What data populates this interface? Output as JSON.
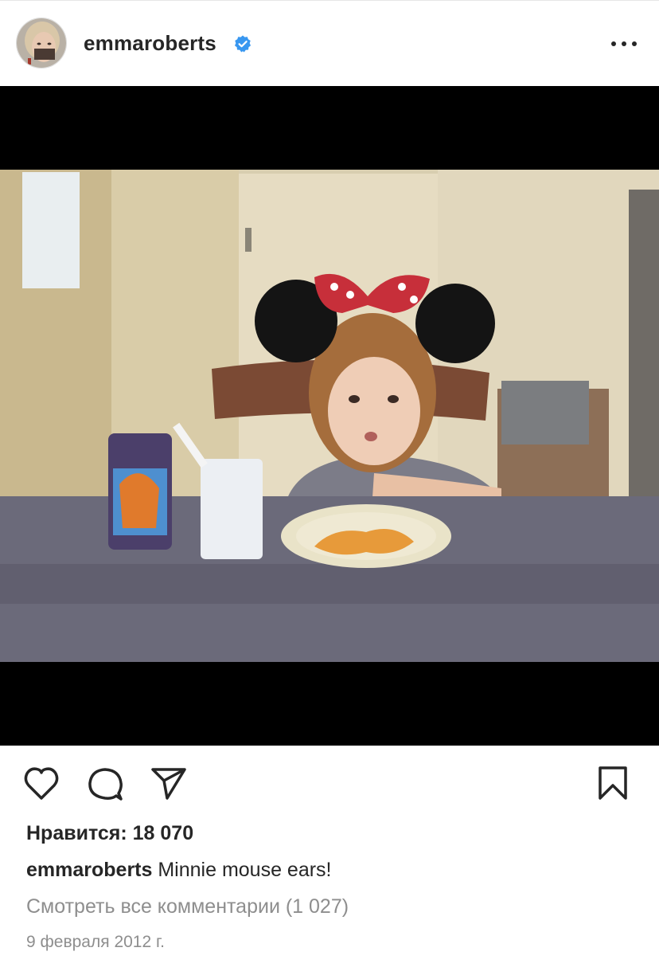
{
  "post": {
    "username": "emmaroberts",
    "verified": true,
    "likes_text": "Нравится: 18 070",
    "caption_username": "emmaroberts",
    "caption_text": " Minnie mouse ears!",
    "view_comments": "Смотреть все комментарии (1 027)",
    "date": "9 февраля 2012 г."
  },
  "icons": {
    "avatar": "avatar",
    "verified": "verified-badge-icon",
    "more": "more-options-icon",
    "like": "heart-icon",
    "comment": "comment-icon",
    "share": "send-icon",
    "save": "bookmark-icon"
  },
  "colors": {
    "verified_blue": "#3897f0",
    "text": "#262626",
    "secondary_text": "#8e8e8e"
  }
}
